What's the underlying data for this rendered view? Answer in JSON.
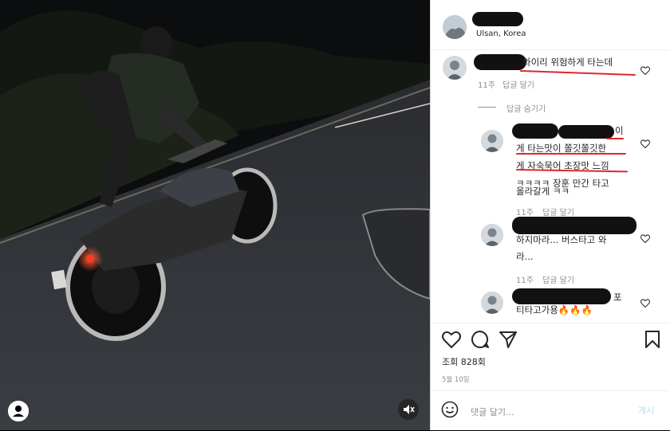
{
  "video": {
    "scene": "motorcycle-stunt-night-road",
    "controls": {
      "mute": "speaker-muted-icon",
      "account": "account-icon"
    }
  },
  "post_header": {
    "location": "Ulsan, Korea"
  },
  "comments": [
    {
      "text": "와이리 위험하게 타는데",
      "age": "11주",
      "reply_label": "답글 달기",
      "hide_replies_label": "답글 숨기기",
      "replies": [
        {
          "lines": [
            "이",
            "게 타는맛이 쫄깃쫄깃한",
            "게 자숙묵어 초장맛 느낌",
            "ㅋㅋㅋㅋ 장훈 만간 타고",
            "올라갈게 ㅋㅋ"
          ],
          "age": "11주",
          "reply_label": "답글 달기"
        },
        {
          "lines": [
            "하지마라... 버스타고 와",
            "라..."
          ],
          "age": "11주",
          "reply_label": "답글 달기"
        },
        {
          "lines": [
            "포",
            "티타고가용🔥🔥🔥"
          ]
        }
      ]
    }
  ],
  "actions": {
    "icons": [
      "heart-icon",
      "comment-icon",
      "share-icon",
      "bookmark-icon"
    ]
  },
  "views_text": "조회 828회",
  "date_text": "5월 10일",
  "add_comment": {
    "placeholder": "댓글 달기...",
    "post_label": "게시"
  },
  "colors": {
    "annotation_red": "#e0262b",
    "post_disabled": "#b2dffc"
  }
}
